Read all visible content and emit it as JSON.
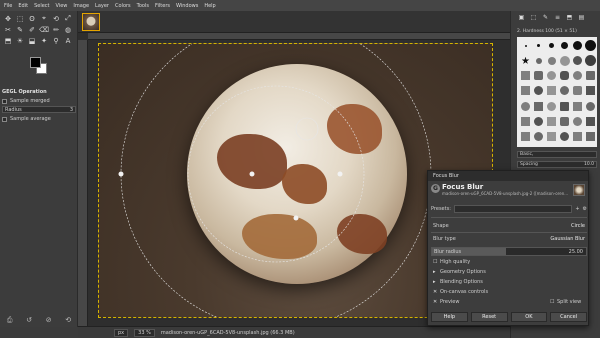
{
  "menu": [
    "File",
    "Edit",
    "Select",
    "View",
    "Image",
    "Layer",
    "Colors",
    "Tools",
    "Filters",
    "Windows",
    "Help"
  ],
  "toolbox": {
    "tools": [
      "✥",
      "⬚",
      "ʘ",
      "⌖",
      "⟲",
      "⤢",
      "✂",
      "✎",
      "✐",
      "⌫",
      "✏",
      "◍",
      "⬒",
      "☀",
      "⬓",
      "✦",
      "⚲",
      "A"
    ],
    "options_title": "GEGL Operation",
    "sample_merged": "Sample merged",
    "radius_label": "Radius",
    "radius_value": "3",
    "sample_average": "Sample average"
  },
  "canvas": {
    "status_unit": "px",
    "status_zoom": "33 %",
    "status_text": "madison-oren-uGP_6CAD-5V8-unsplash.jpg (66.3 MB)"
  },
  "dock": {
    "tabs": [
      "▣",
      "⬚",
      "✎",
      "≡",
      "⬒",
      "▤"
    ],
    "brush_title": "2. Hardness 100 (51 × 51)",
    "brush_tag": "Basic,",
    "spacing_label": "Spacing",
    "spacing_value": "10.0"
  },
  "dialog": {
    "window_title": "Focus Blur",
    "title": "Focus Blur",
    "subtitle": "madison-oren-uGP_6CAD-5V8-unsplash.jpg-2 ([madison-oren...",
    "presets_label": "Presets:",
    "shape_label": "Shape",
    "shape_value": "Circle",
    "blur_type_label": "Blur type",
    "blur_type_value": "Gaussian Blur",
    "blur_radius_label": "Blur radius",
    "blur_radius_value": "25.00",
    "high_quality": "High quality",
    "geometry_options": "Geometry Options",
    "blending_options": "Blending Options",
    "on_canvas": "On-canvas controls",
    "preview": "Preview",
    "split_view": "Split view",
    "buttons": {
      "help": "Help",
      "reset": "Reset",
      "ok": "OK",
      "cancel": "Cancel"
    }
  }
}
